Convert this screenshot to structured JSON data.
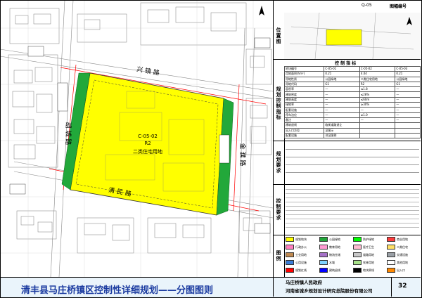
{
  "footer": {
    "title": "清丰县马庄桥镇区控制性详细规划——分图图则",
    "government": "马庄桥镇人民政府",
    "institute": "河南省城乡规划设计研究总院股份有限公司",
    "page": "32"
  },
  "panel": {
    "index_title": "图幅编号",
    "index_value": "Q-05",
    "location_label": "位置图",
    "control_header": "控 制 指 标",
    "sections": [
      "规划控制指标",
      "规划要求",
      "控制要求",
      "图例"
    ],
    "kv_rows": [
      [
        "地块编号",
        "C-05-01",
        "C-05-02",
        "C-05-03"
      ],
      [
        "用地面积(hm²)",
        "0.21",
        "4.04",
        "0.21"
      ],
      [
        "用地性质",
        "公园绿地",
        "二类住宅用地",
        "公园绿地"
      ],
      [
        "用地代码",
        "G1",
        "R2",
        "G1"
      ],
      [
        "容积率",
        "—",
        "≤1.8",
        "—"
      ],
      [
        "建筑密度",
        "—",
        "≤28%",
        "—"
      ],
      [
        "建筑高度",
        "—",
        "≤60m",
        "—"
      ],
      [
        "绿地率",
        "—",
        "≥30%",
        "—"
      ],
      [
        "配套设施",
        "—",
        "—",
        "—"
      ],
      [
        "停车泊位",
        "—",
        "≥1.0",
        "—"
      ],
      [
        "备注",
        "—",
        "—",
        "—"
      ],
      [
        "建筑退线",
        "临街道路退让",
        "",
        ""
      ],
      [
        "出入口方位",
        "见图示",
        "",
        ""
      ],
      [
        "配套设施",
        "详见图例",
        "",
        ""
      ]
    ]
  },
  "map": {
    "plot_label_1": "C-05-02",
    "plot_label_2": "R2",
    "plot_label_3": "二类住宅用地",
    "roads": [
      "兴 镇 路",
      "清 民 路",
      "胡 城 路",
      "金 濮 路"
    ]
  },
  "legend": [
    {
      "label": "规划地块",
      "color": "#ffff00"
    },
    {
      "label": "公园绿地",
      "color": "#22a83a"
    },
    {
      "label": "防护绿地",
      "color": "#00ff00"
    },
    {
      "label": "商业用地",
      "color": "#ff3c3c"
    },
    {
      "label": "行政办公",
      "color": "#ff7fbf"
    },
    {
      "label": "教育用地",
      "color": "#ff9ad2"
    },
    {
      "label": "医疗卫生",
      "color": "#ffbcd2"
    },
    {
      "label": "二类住宅",
      "color": "#ffe066"
    },
    {
      "label": "工业用地",
      "color": "#c08a52"
    },
    {
      "label": "物流仓储",
      "color": "#a672c8"
    },
    {
      "label": "道路用地",
      "color": "#c8c8c8"
    },
    {
      "label": "交通设施",
      "color": "#9aa0a6"
    },
    {
      "label": "公用设施",
      "color": "#3a7dd8"
    },
    {
      "label": "水域",
      "color": "#7fd4ff"
    },
    {
      "label": "农林用地",
      "color": "#a8e28a"
    },
    {
      "label": "其他用地",
      "color": "#ffffff"
    },
    {
      "label": "规划红线",
      "color": "#ff0000"
    },
    {
      "label": "建筑退线",
      "color": "#0000ff"
    },
    {
      "label": "地块界线",
      "color": "#000000"
    },
    {
      "label": "出入口",
      "color": "#ff8800"
    }
  ],
  "colors": {
    "residential": "#ffff00",
    "green": "#22a83a",
    "red_line": "#ff0000",
    "footer_title": "#1a3aa0"
  }
}
